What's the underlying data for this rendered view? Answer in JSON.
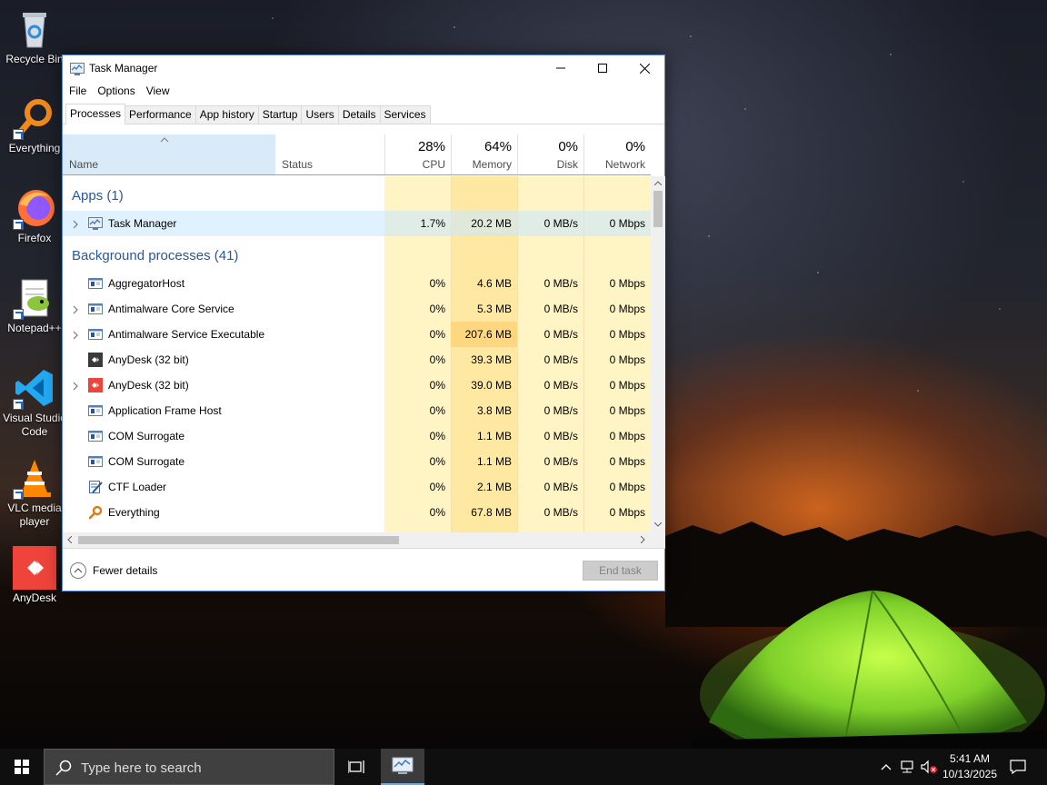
{
  "desktop": {
    "icons": [
      {
        "label": "Recycle Bin"
      },
      {
        "label": "Everything"
      },
      {
        "label": "Firefox"
      },
      {
        "label": "Notepad++"
      },
      {
        "label": "Visual Studio Code"
      },
      {
        "label": "VLC media player"
      },
      {
        "label": "AnyDesk"
      }
    ]
  },
  "window": {
    "title": "Task Manager",
    "menu": [
      "File",
      "Options",
      "View"
    ],
    "tabs": [
      "Processes",
      "Performance",
      "App history",
      "Startup",
      "Users",
      "Details",
      "Services"
    ],
    "active_tab": "Processes",
    "columns": {
      "name": "Name",
      "status": "Status",
      "cpu": {
        "pct": "28%",
        "label": "CPU"
      },
      "memory": {
        "pct": "64%",
        "label": "Memory"
      },
      "disk": {
        "pct": "0%",
        "label": "Disk"
      },
      "network": {
        "pct": "0%",
        "label": "Network"
      }
    },
    "groups": {
      "apps": "Apps (1)",
      "background": "Background processes (41)"
    },
    "apps": [
      {
        "name": "Task Manager",
        "cpu": "1.7%",
        "memory": "20.2 MB",
        "disk": "0 MB/s",
        "network": "0 Mbps",
        "expandable": true,
        "icon": "task-manager-icon"
      }
    ],
    "processes": [
      {
        "name": "AggregatorHost",
        "cpu": "0%",
        "memory": "4.6 MB",
        "disk": "0 MB/s",
        "network": "0 Mbps",
        "expandable": false,
        "icon": "service-icon"
      },
      {
        "name": "Antimalware Core Service",
        "cpu": "0%",
        "memory": "5.3 MB",
        "disk": "0 MB/s",
        "network": "0 Mbps",
        "expandable": true,
        "icon": "service-icon"
      },
      {
        "name": "Antimalware Service Executable",
        "cpu": "0%",
        "memory": "207.6 MB",
        "disk": "0 MB/s",
        "network": "0 Mbps",
        "expandable": true,
        "icon": "service-icon"
      },
      {
        "name": "AnyDesk (32 bit)",
        "cpu": "0%",
        "memory": "39.3 MB",
        "disk": "0 MB/s",
        "network": "0 Mbps",
        "expandable": false,
        "icon": "anydesk-dark-icon"
      },
      {
        "name": "AnyDesk (32 bit)",
        "cpu": "0%",
        "memory": "39.0 MB",
        "disk": "0 MB/s",
        "network": "0 Mbps",
        "expandable": true,
        "icon": "anydesk-icon"
      },
      {
        "name": "Application Frame Host",
        "cpu": "0%",
        "memory": "3.8 MB",
        "disk": "0 MB/s",
        "network": "0 Mbps",
        "expandable": false,
        "icon": "service-icon"
      },
      {
        "name": "COM Surrogate",
        "cpu": "0%",
        "memory": "1.1 MB",
        "disk": "0 MB/s",
        "network": "0 Mbps",
        "expandable": false,
        "icon": "service-icon"
      },
      {
        "name": "COM Surrogate",
        "cpu": "0%",
        "memory": "1.1 MB",
        "disk": "0 MB/s",
        "network": "0 Mbps",
        "expandable": false,
        "icon": "service-icon"
      },
      {
        "name": "CTF Loader",
        "cpu": "0%",
        "memory": "2.1 MB",
        "disk": "0 MB/s",
        "network": "0 Mbps",
        "expandable": false,
        "icon": "ctf-loader-icon"
      },
      {
        "name": "Everything",
        "cpu": "0%",
        "memory": "67.8 MB",
        "disk": "0 MB/s",
        "network": "0 Mbps",
        "expandable": false,
        "icon": "everything-icon"
      }
    ],
    "footer": {
      "fewer_details": "Fewer details",
      "end_task": "End task"
    }
  },
  "taskbar": {
    "search_placeholder": "Type here to search",
    "time": "5:41 AM",
    "date": "10/13/2025"
  },
  "colors": {
    "accent_blue": "#2b5797",
    "cell_light": "#fff4c4",
    "cell_mid": "#ffe8a1",
    "cell_hi": "#ffd780",
    "header_sel": "#d9ebf9"
  }
}
